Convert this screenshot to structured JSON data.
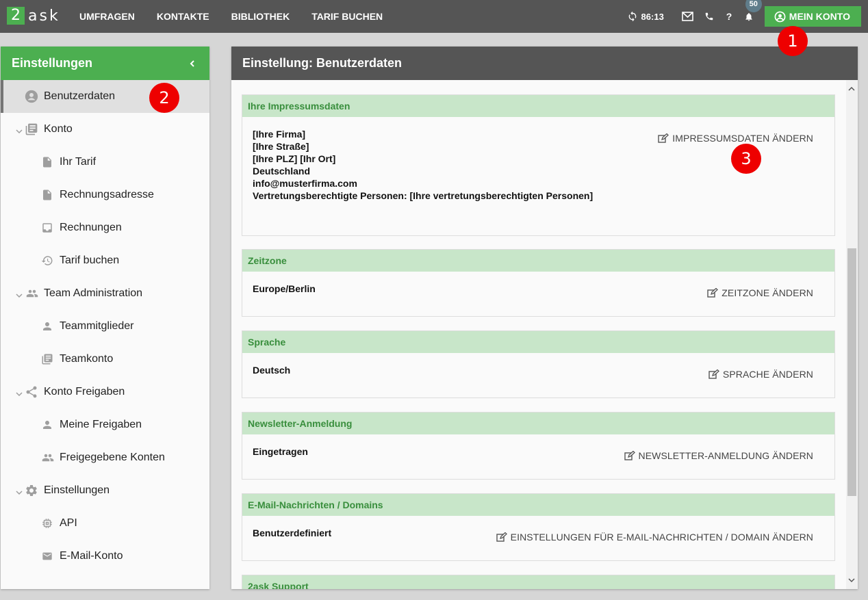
{
  "app": {
    "logo_box": "2",
    "logo_rest": "ask"
  },
  "nav": {
    "items": [
      "UMFRAGEN",
      "KONTAKTE",
      "BIBLIOTHEK",
      "TARIF BUCHEN"
    ]
  },
  "header": {
    "timer": "86:13",
    "notification_count": "50",
    "account_button": "MEIN KONTO"
  },
  "markers": [
    "1",
    "2",
    "3"
  ],
  "sidebar": {
    "title": "Einstellungen",
    "items": [
      {
        "label": "Benutzerdaten"
      },
      {
        "label": "Konto"
      },
      {
        "label": "Ihr Tarif"
      },
      {
        "label": "Rechnungsadresse"
      },
      {
        "label": "Rechnungen"
      },
      {
        "label": "Tarif buchen"
      },
      {
        "label": "Team Administration"
      },
      {
        "label": "Teammitglieder"
      },
      {
        "label": "Teamkonto"
      },
      {
        "label": "Konto Freigaben"
      },
      {
        "label": "Meine Freigaben"
      },
      {
        "label": "Freigegebene Konten"
      },
      {
        "label": "Einstellungen"
      },
      {
        "label": "API"
      },
      {
        "label": "E-Mail-Konto"
      }
    ]
  },
  "main": {
    "title": "Einstellung: Benutzerdaten",
    "sections": [
      {
        "title": "Ihre Impressumsdaten",
        "lines": [
          "[Ihre Firma]",
          "[Ihre Straße]",
          "[Ihre PLZ] [Ihr Ort]",
          "Deutschland",
          "info@musterfirma.com",
          "Vertretungsberechtigte Personen: [Ihre vertretungsberechtigten Personen]"
        ],
        "action": "IMPRESSUMSDATEN ÄNDERN"
      },
      {
        "title": "Zeitzone",
        "value": "Europe/Berlin",
        "action": "ZEITZONE ÄNDERN"
      },
      {
        "title": "Sprache",
        "value": "Deutsch",
        "action": "SPRACHE ÄNDERN"
      },
      {
        "title": "Newsletter-Anmeldung",
        "value": "Eingetragen",
        "action": "NEWSLETTER-ANMELDUNG ÄNDERN"
      },
      {
        "title": "E-Mail-Nachrichten / Domains",
        "value": "Benutzerdefiniert",
        "action": "EINSTELLUNGEN FÜR E-MAIL-NACHRICHTEN / DOMAIN ÄNDERN"
      },
      {
        "title": "2ask Support"
      }
    ]
  },
  "colors": {
    "brand_green": "#4caf50",
    "section_header_bg": "#c8e6c9",
    "section_header_text": "#388e3c",
    "topbar": "#555555",
    "marker_red": "#ee0000"
  },
  "icons": [
    "refresh-icon",
    "envelope-icon",
    "phone-icon",
    "help-icon",
    "bell-icon",
    "account-circle-icon",
    "edit-icon"
  ]
}
